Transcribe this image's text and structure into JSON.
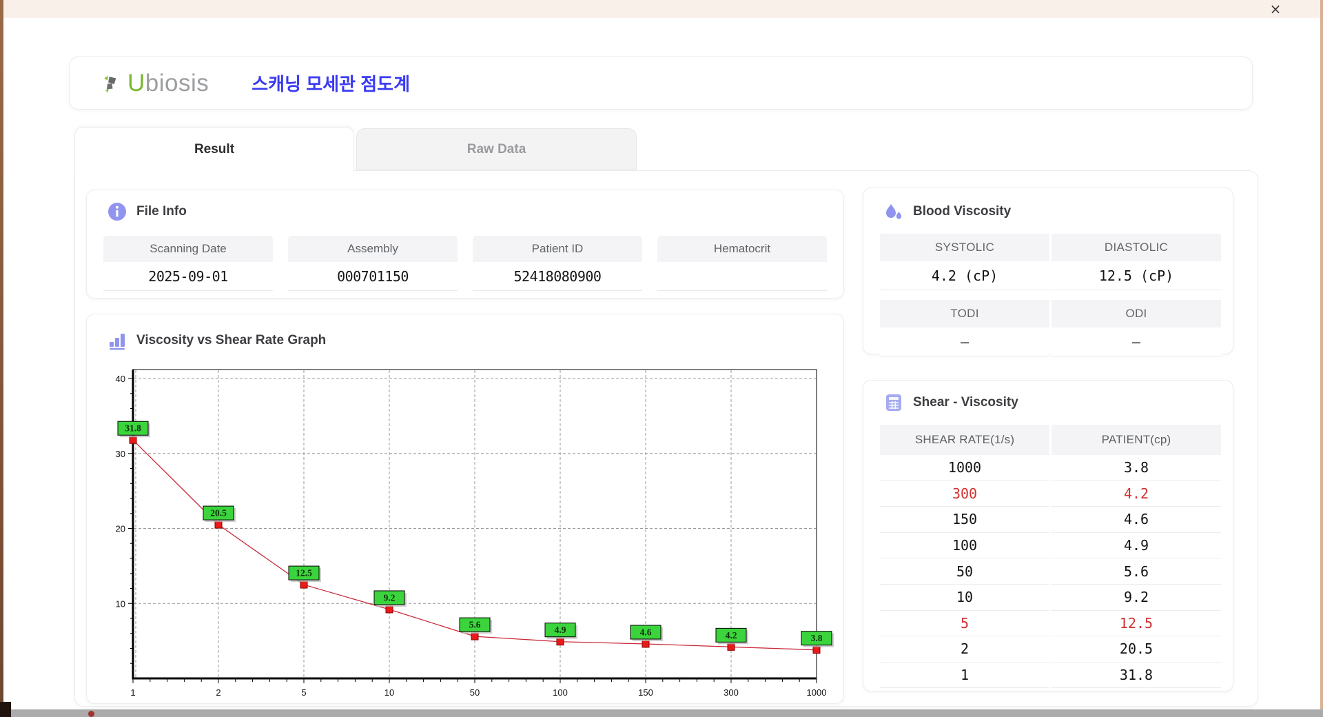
{
  "window": {
    "close_label": "×"
  },
  "colors": {
    "accent_lavender": "#9094ee",
    "brand_green": "#76b82e",
    "brand_gray": "#9c9ea0",
    "title_blue": "#3a3af2",
    "alert_red": "#d03030",
    "chart_line": "#c92a3a",
    "chart_marker": "#ea1a1a",
    "chart_label_bg": "#3cd43c"
  },
  "header": {
    "brand_u": "U",
    "brand_rest": "biosis",
    "title_ko": "스캐닝 모세관 점도계"
  },
  "tabs": [
    {
      "label": "Result",
      "active": true
    },
    {
      "label": "Raw Data",
      "active": false
    }
  ],
  "file_info": {
    "title": "File Info",
    "fields": [
      {
        "label": "Scanning Date",
        "value": "2025-09-01"
      },
      {
        "label": "Assembly",
        "value": "000701150"
      },
      {
        "label": "Patient ID",
        "value": "52418080900"
      },
      {
        "label": "Hematocrit",
        "value": ""
      }
    ]
  },
  "blood_viscosity": {
    "title": "Blood Viscosity",
    "rows": [
      {
        "cells": [
          {
            "label": "SYSTOLIC",
            "value": "4.2 (cP)"
          },
          {
            "label": "DIASTOLIC",
            "value": "12.5 (cP)"
          }
        ]
      },
      {
        "cells": [
          {
            "label": "TODI",
            "value": "–"
          },
          {
            "label": "ODI",
            "value": "–"
          }
        ]
      }
    ]
  },
  "shear_table": {
    "title": "Shear - Viscosity",
    "columns": [
      "SHEAR RATE(1/s)",
      "PATIENT(cp)"
    ],
    "rows": [
      {
        "shear": "1000",
        "patient": "3.8",
        "highlight": false
      },
      {
        "shear": "300",
        "patient": "4.2",
        "highlight": true
      },
      {
        "shear": "150",
        "patient": "4.6",
        "highlight": false
      },
      {
        "shear": "100",
        "patient": "4.9",
        "highlight": false
      },
      {
        "shear": "50",
        "patient": "5.6",
        "highlight": false
      },
      {
        "shear": "10",
        "patient": "9.2",
        "highlight": false
      },
      {
        "shear": "5",
        "patient": "12.5",
        "highlight": true
      },
      {
        "shear": "2",
        "patient": "20.5",
        "highlight": false
      },
      {
        "shear": "1",
        "patient": "31.8",
        "highlight": false
      }
    ]
  },
  "chart_data": {
    "type": "line",
    "title": "Viscosity vs Shear Rate Graph",
    "x_categories": [
      "1",
      "2",
      "5",
      "10",
      "50",
      "100",
      "150",
      "300",
      "1000"
    ],
    "values": [
      31.8,
      20.5,
      12.5,
      9.2,
      5.6,
      4.9,
      4.6,
      4.2,
      3.8
    ],
    "point_labels": [
      "31.8",
      "20.5",
      "12.5",
      "9.2",
      "5.6",
      "4.9",
      "4.6",
      "4.2",
      "3.8"
    ],
    "y_ticks": [
      10,
      20,
      30,
      40
    ],
    "ylim": [
      0,
      41.2
    ],
    "grid": true,
    "legend": "none"
  }
}
